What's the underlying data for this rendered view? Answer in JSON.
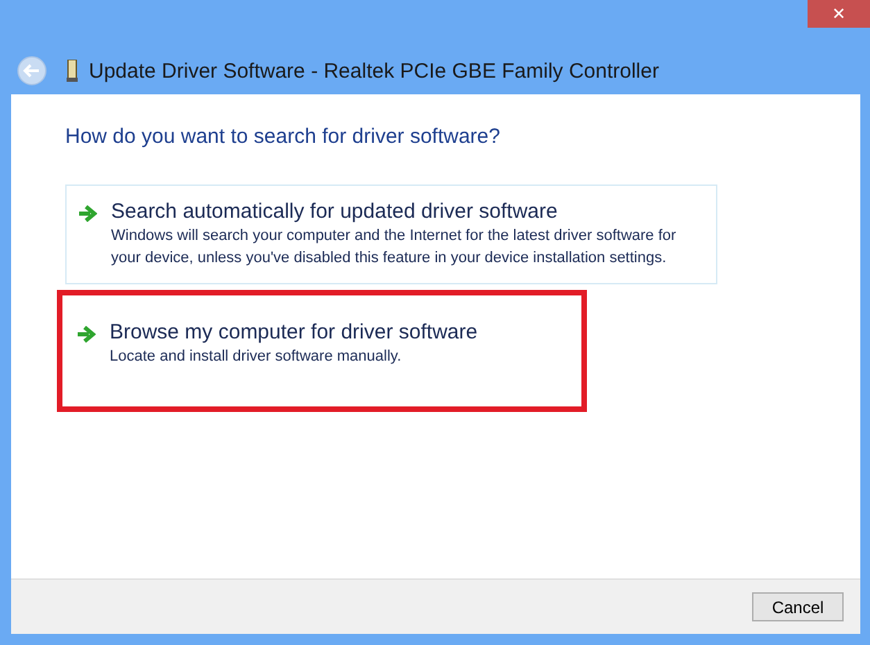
{
  "window": {
    "title": "Update Driver Software - Realtek PCIe GBE Family Controller",
    "close": "✕"
  },
  "heading": "How do you want to search for driver software?",
  "options": [
    {
      "title": "Search automatically for updated driver software",
      "description": "Windows will search your computer and the Internet for the latest driver software for your device, unless you've disabled this feature in your device installation settings.",
      "highlighted": true,
      "annotated": false
    },
    {
      "title": "Browse my computer for driver software",
      "description": "Locate and install driver software manually.",
      "highlighted": false,
      "annotated": true
    }
  ],
  "buttons": [
    "Cancel"
  ]
}
